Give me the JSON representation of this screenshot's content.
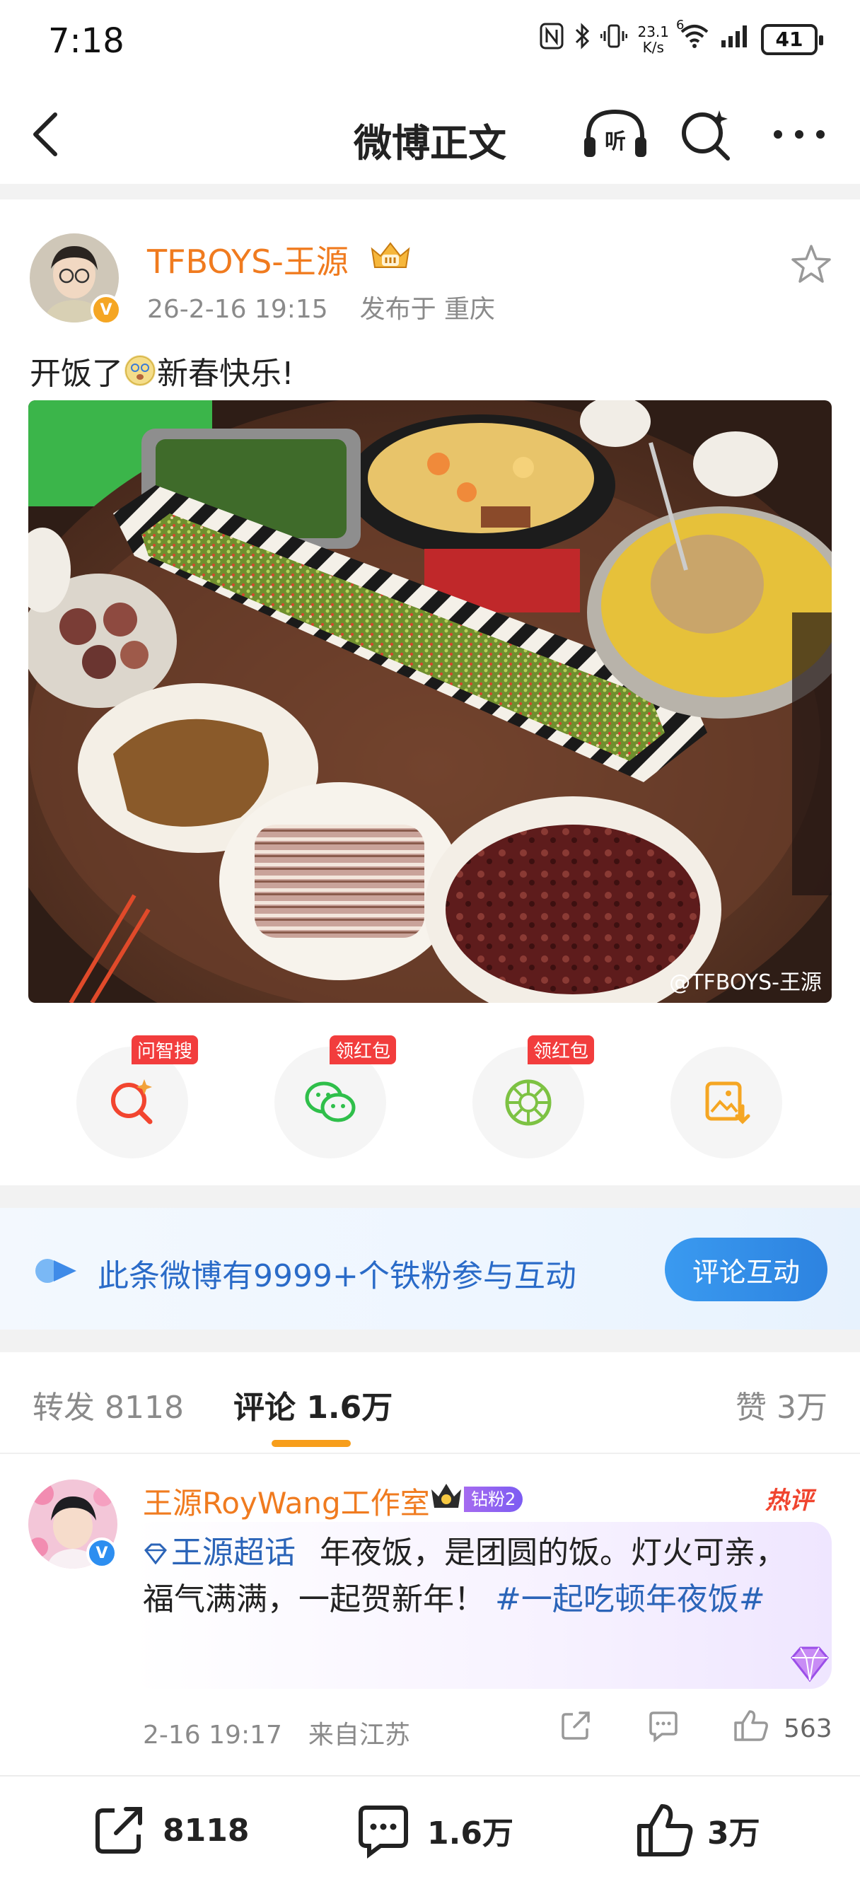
{
  "status_bar": {
    "time": "7:18",
    "net_speed_value": "23.1",
    "net_speed_unit": "K/s",
    "signal_label": "6",
    "battery": "41"
  },
  "header": {
    "title": "微博正文",
    "listen_label": "听"
  },
  "post": {
    "username": "TFBOYS-王源",
    "timestamp": "26-2-16 19:15",
    "location": "发布于 重庆",
    "text_before_emoji": "开饭了",
    "text_after_emoji": "新春快乐!",
    "image_watermark": "@TFBOYS-王源",
    "verified_badge": "V"
  },
  "actions": [
    {
      "tag": "问智搜",
      "icon": "ai-search-icon",
      "color": "#f2452f"
    },
    {
      "tag": "领红包",
      "icon": "wechat-icon",
      "color": "#2fbf4a"
    },
    {
      "tag": "领红包",
      "icon": "moments-icon",
      "color": "#7dc243"
    },
    {
      "tag": "",
      "icon": "save-image-icon",
      "color": "#f5a623"
    }
  ],
  "fans_banner": {
    "text": "此条微博有9999+个铁粉参与互动",
    "button": "评论互动"
  },
  "tabs": {
    "repost": "转发 8118",
    "comment": "评论 1.6万",
    "like": "赞 3万"
  },
  "comment": {
    "author": "王源RoyWang工作室",
    "fan_badge": "钻粉2",
    "hot_tag": "热评",
    "topic": "王源超话",
    "text": "年夜饭，是团圆的饭。灯火可亲，福气满满，一起贺新年！",
    "hashtag": "#一起吃顿年夜饭#",
    "time": "2-16 19:17",
    "location": "来自江苏",
    "likes": "563",
    "verified_badge": "V"
  },
  "footer": {
    "reposts": "8118",
    "comments": "1.6万",
    "likes": "3万"
  },
  "colors": {
    "username_orange": "#f07b1f",
    "link_blue": "#2b64b8",
    "tab_accent": "#f79e1b",
    "button_blue": "#3a9af0",
    "hot_red": "#f0452f"
  }
}
